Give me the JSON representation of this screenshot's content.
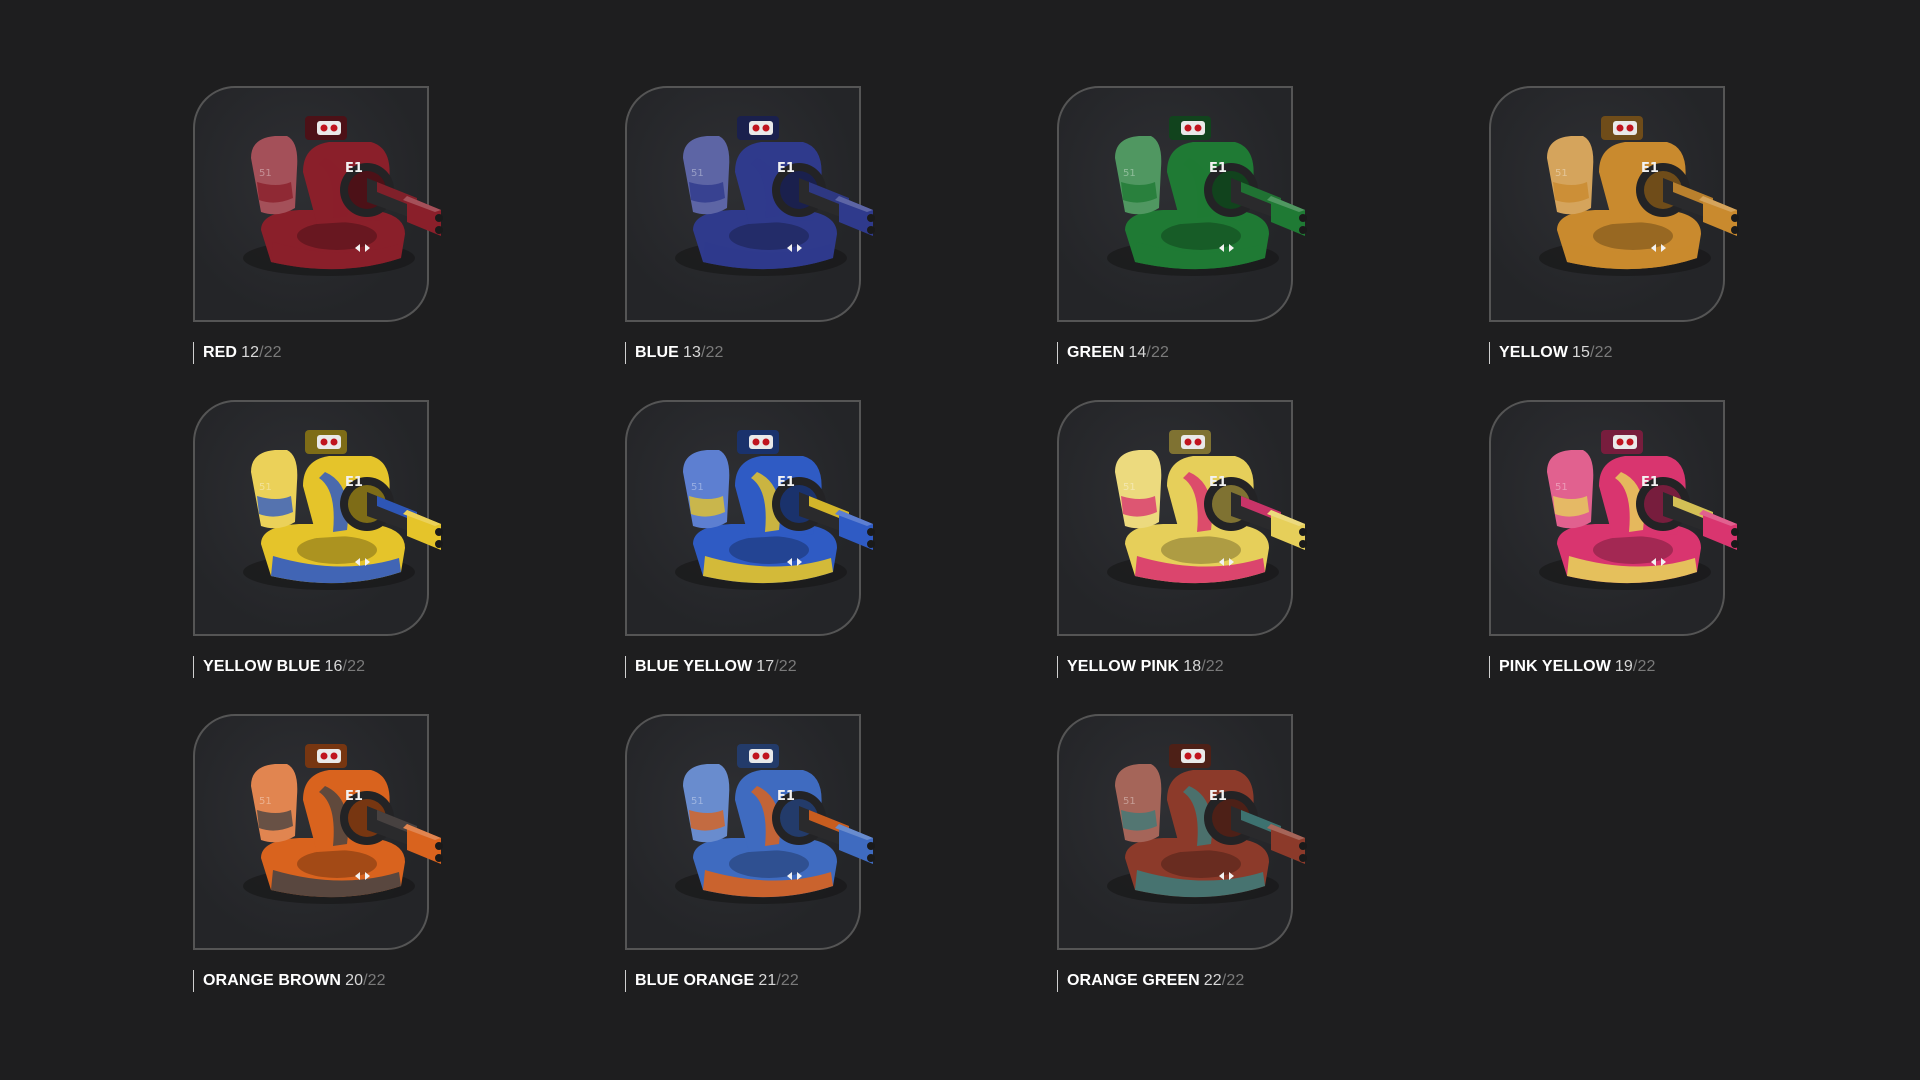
{
  "variants": [
    {
      "name": "RED",
      "index": "12",
      "total": "/22",
      "colors": [
        "#8a1f2a",
        "#8a1f2a"
      ]
    },
    {
      "name": "BLUE",
      "index": "13",
      "total": "/22",
      "colors": [
        "#2f3a8c",
        "#2f3a8c"
      ]
    },
    {
      "name": "GREEN",
      "index": "14",
      "total": "/22",
      "colors": [
        "#1f7a34",
        "#1f7a34"
      ]
    },
    {
      "name": "YELLOW",
      "index": "15",
      "total": "/22",
      "colors": [
        "#c98a2e",
        "#c98a2e"
      ]
    },
    {
      "name": "YELLOW BLUE",
      "index": "16",
      "total": "/22",
      "colors": [
        "#e5c42a",
        "#2f5bc4"
      ]
    },
    {
      "name": "BLUE YELLOW",
      "index": "17",
      "total": "/22",
      "colors": [
        "#2f5bc4",
        "#e5c42a"
      ]
    },
    {
      "name": "YELLOW PINK",
      "index": "18",
      "total": "/22",
      "colors": [
        "#e6cf5a",
        "#d9356f"
      ]
    },
    {
      "name": "PINK YELLOW",
      "index": "19",
      "total": "/22",
      "colors": [
        "#d9356f",
        "#e6cf5a"
      ]
    },
    {
      "name": "ORANGE BROWN",
      "index": "20",
      "total": "/22",
      "colors": [
        "#d9631e",
        "#4a4442"
      ]
    },
    {
      "name": "BLUE ORANGE",
      "index": "21",
      "total": "/22",
      "colors": [
        "#3f6bc0",
        "#d9631e"
      ]
    },
    {
      "name": "ORANGE GREEN",
      "index": "22",
      "total": "/22",
      "colors": [
        "#8c3a2a",
        "#3f7a78"
      ]
    }
  ]
}
